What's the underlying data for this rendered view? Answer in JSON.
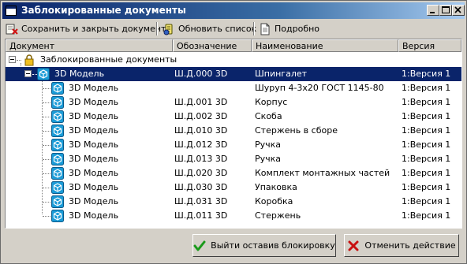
{
  "window": {
    "title": "Заблокированные документы",
    "accent": "#0a246a",
    "controls": {
      "minimize_glyph": "_",
      "maximize_glyph": "□",
      "close_glyph": "×"
    }
  },
  "toolbar": {
    "save_close_label": "Сохранить и закрыть документ",
    "refresh_label": "Обновить список",
    "details_label": "Подробно"
  },
  "table": {
    "columns": [
      "Документ",
      "Обозначение",
      "Наименование",
      "Версия"
    ],
    "root_label": "Заблокированные документы",
    "rows": [
      {
        "document": "3D Модель",
        "designation": "Ш.Д.000 3D",
        "name": "Шпингалет",
        "version": "1:Версия 1",
        "selected": true
      },
      {
        "document": "3D Модель",
        "designation": "",
        "name": "Шуруп 4-3х20 ГОСТ 1145-80",
        "version": "1:Версия 1"
      },
      {
        "document": "3D Модель",
        "designation": "Ш.Д.001 3D",
        "name": "Корпус",
        "version": "1:Версия 1"
      },
      {
        "document": "3D Модель",
        "designation": "Ш.Д.002 3D",
        "name": "Скоба",
        "version": "1:Версия 1"
      },
      {
        "document": "3D Модель",
        "designation": "Ш.Д.010 3D",
        "name": "Стержень в сборе",
        "version": "1:Версия 1"
      },
      {
        "document": "3D Модель",
        "designation": "Ш.Д.012 3D",
        "name": "Ручка",
        "version": "1:Версия 1"
      },
      {
        "document": "3D Модель",
        "designation": "Ш.Д.013 3D",
        "name": "Ручка",
        "version": "1:Версия 1"
      },
      {
        "document": "3D Модель",
        "designation": "Ш.Д.020 3D",
        "name": "Комплект монтажных частей",
        "version": "1:Версия 1"
      },
      {
        "document": "3D Модель",
        "designation": "Ш.Д.030 3D",
        "name": "Упаковка",
        "version": "1:Версия 1"
      },
      {
        "document": "3D Модель",
        "designation": "Ш.Д.031 3D",
        "name": "Коробка",
        "version": "1:Версия 1"
      },
      {
        "document": "3D Модель",
        "designation": "Ш.Д.011 3D",
        "name": "Стержень",
        "version": "1:Версия 1"
      }
    ]
  },
  "buttons": {
    "exit_keep_lock_label": "Выйти оставив блокировку",
    "cancel_action_label": "Отменить действие"
  },
  "icons": {
    "window": "window-app-icon",
    "save_close": "save-close-icon",
    "refresh": "refresh-icon",
    "details": "details-icon",
    "root": "lock-icon",
    "row": "3d-model-cube-icon",
    "exit": "checkmark-icon",
    "cancel": "cancel-x-icon"
  }
}
